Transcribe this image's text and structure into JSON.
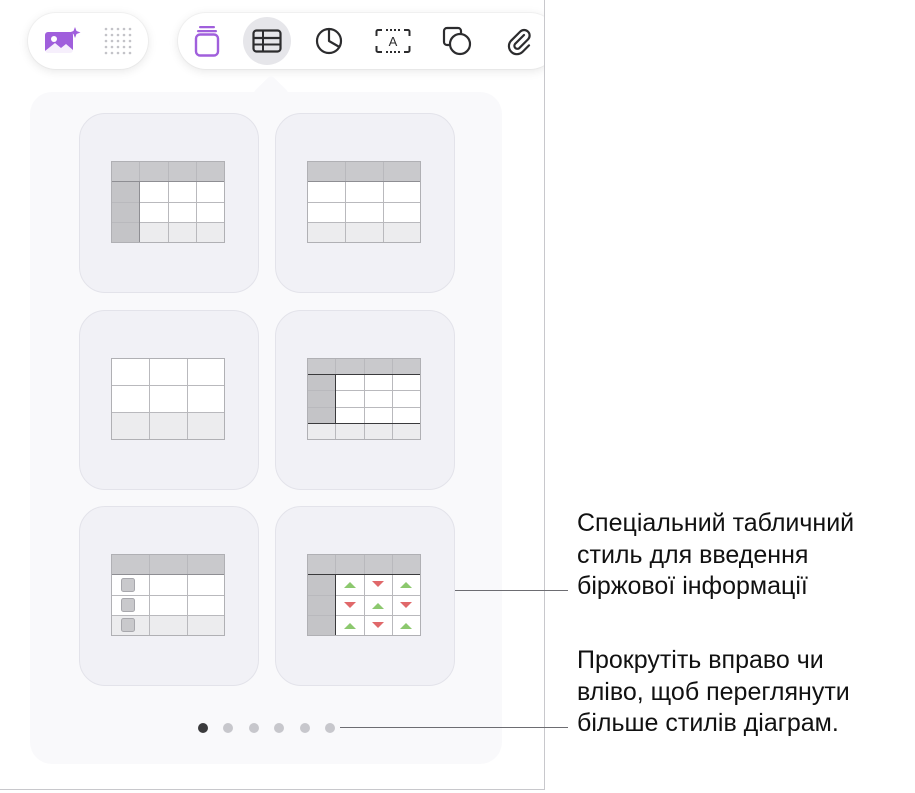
{
  "toolbar": {
    "left_buttons": [
      {
        "icon": "image-sparkle-icon"
      },
      {
        "icon": "dot-grid-icon"
      }
    ],
    "right_buttons": [
      {
        "icon": "shapes-stack-icon",
        "selected": false
      },
      {
        "icon": "table-icon",
        "selected": true
      },
      {
        "icon": "pie-chart-icon",
        "selected": false
      },
      {
        "icon": "text-box-icon",
        "label": "A",
        "selected": false
      },
      {
        "icon": "shape-icon",
        "selected": false
      },
      {
        "icon": "paperclip-icon",
        "selected": false
      }
    ],
    "accent_color": "#a05fdc"
  },
  "table_styles": [
    {
      "name": "header-row-and-column",
      "selected": false
    },
    {
      "name": "header-row",
      "selected": false
    },
    {
      "name": "plain",
      "selected": false
    },
    {
      "name": "header-row-column-footer",
      "selected": false
    },
    {
      "name": "checklist",
      "selected": false
    },
    {
      "name": "stock",
      "selected": false
    }
  ],
  "stock_arrows": {
    "up_color": "#8cc86e",
    "down_color": "#e0686a"
  },
  "pagination": {
    "count": 6,
    "current": 1
  },
  "callouts": {
    "stock_style": [
      "Спеціальний табличний",
      "стиль для введення",
      "біржової інформації"
    ],
    "scroll_hint": [
      "Прокрутіть вправо чи",
      "вліво, щоб переглянути",
      "більше стилів діаграм."
    ]
  }
}
